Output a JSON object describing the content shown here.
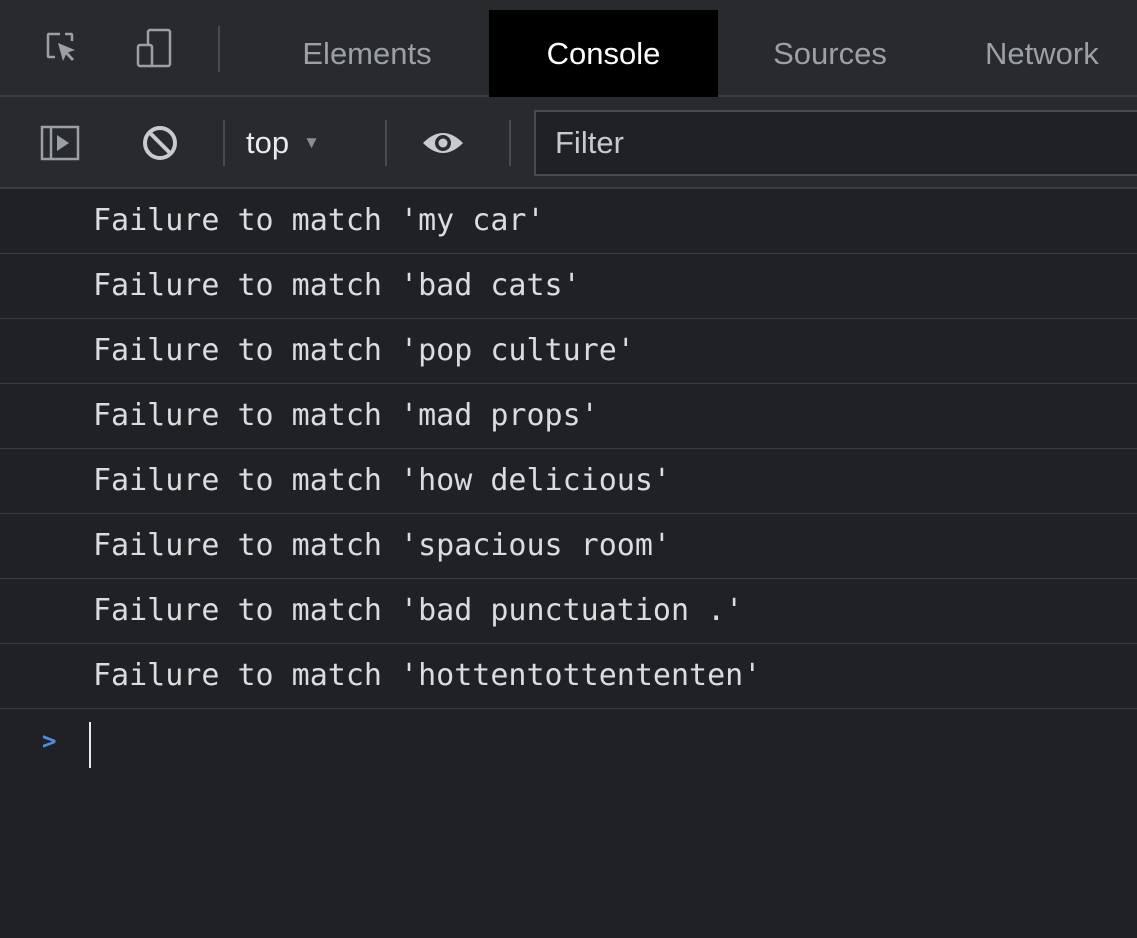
{
  "tabbar": {
    "inspect_icon": "inspect-element-icon",
    "device_icon": "device-toolbar-icon",
    "tabs": [
      {
        "label": "Elements",
        "active": false
      },
      {
        "label": "Console",
        "active": true
      },
      {
        "label": "Sources",
        "active": false
      },
      {
        "label": "Network",
        "active": false
      }
    ]
  },
  "toolbar": {
    "sidebar_icon": "show-console-sidebar-icon",
    "clear_icon": "clear-console-icon",
    "context": "top",
    "eye_icon": "live-expression-eye-icon",
    "filter_placeholder": "Filter"
  },
  "console": {
    "messages": [
      "Failure to match 'my car'",
      "Failure to match 'bad cats'",
      "Failure to match 'pop culture'",
      "Failure to match 'mad props'",
      "Failure to match 'how delicious'",
      "Failure to match 'spacious room'",
      "Failure to match 'bad punctuation .'",
      "Failure to match 'hottentottententen'"
    ],
    "prompt_symbol": ">"
  },
  "colors": {
    "background": "#202124",
    "toolbar": "#292a2d",
    "active_tab": "#000000",
    "prompt_accent": "#4f8de6"
  }
}
